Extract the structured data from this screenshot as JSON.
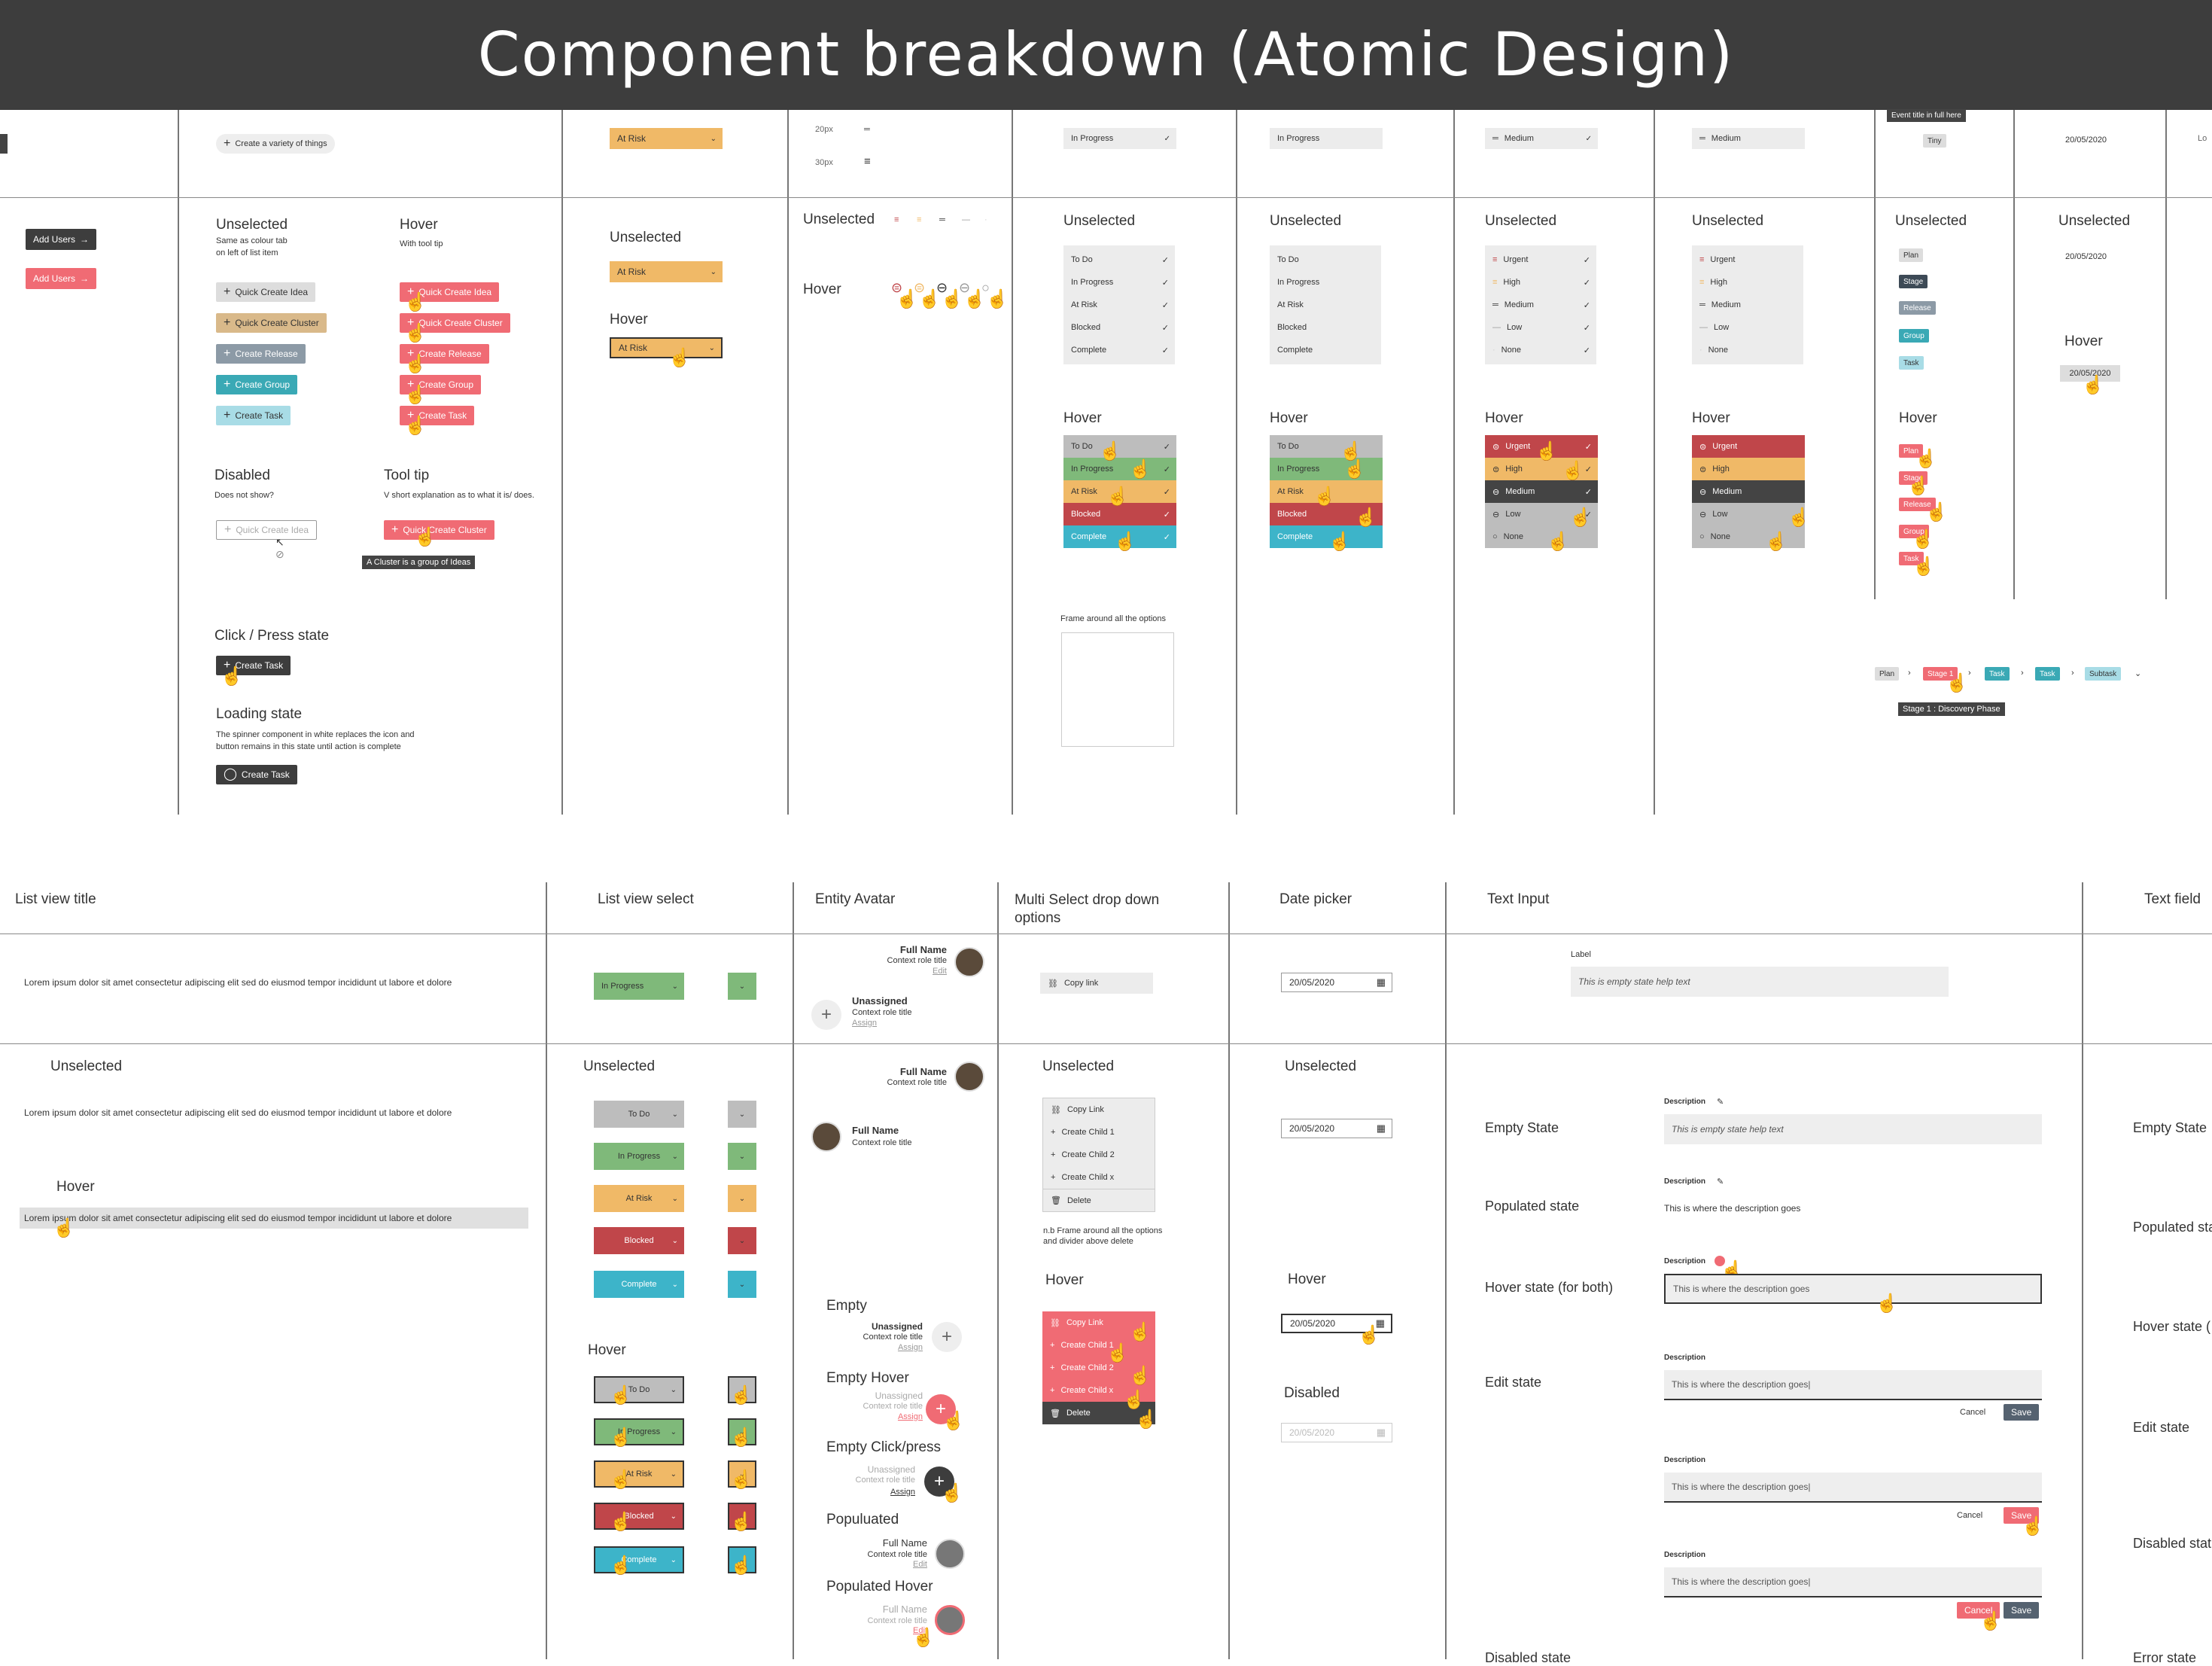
{
  "header": {
    "title": "Component breakdown (Atomic Design)"
  },
  "colors": {
    "gray": "#bdbdbd",
    "green": "#7fb97a",
    "amber": "#f0b967",
    "red": "#c0464a",
    "blue": "#3db4c9",
    "pink": "#f06b74",
    "dark": "#3d3d3d",
    "tan": "#d9b98a",
    "slate": "#8c9aa6",
    "teal": "#3aa9b5",
    "lightblue": "#a8dce6"
  },
  "top": {
    "create_variety": "Create a variety of things",
    "at_risk": "At Risk",
    "px20": "20px",
    "px30": "30px",
    "in_progress": "In Progress",
    "in_progress2": "In Progress",
    "medium": "Medium",
    "medium2": "Medium",
    "event_tip": "Event title in full here",
    "tiny": "Tiny",
    "date": "20/05/2020",
    "lo": "Lo"
  },
  "buttons": {
    "add_users": "Add Users",
    "add_users2": "Add Users",
    "unselected": "Unselected",
    "unselected_note": "Same as colour tab\non left of list item",
    "hover": "Hover",
    "hover_note": "With tool tip",
    "items": [
      "Quick Create Idea",
      "Quick Create Cluster",
      "Create Release",
      "Create Group",
      "Create Task"
    ],
    "disabled": "Disabled",
    "disabled_note": "Does not show?",
    "disabled_btn": "Quick Create Idea",
    "tooltip": "Tool tip",
    "tooltip_note": "V short explanation as to what it is/ does.",
    "tooltip_btn": "Quick Create Cluster",
    "tooltip_text": "A Cluster is a group of Ideas",
    "click": "Click / Press state",
    "click_btn": "Create Task",
    "loading": "Loading state",
    "loading_note": "The spinner component in white replaces the icon and\nbutton remains in this state until action is complete",
    "loading_btn": "Create Task"
  },
  "risk": {
    "unselected": "Unselected",
    "hover": "Hover",
    "value": "At Risk",
    "value2": "At Risk"
  },
  "icons": {
    "unselected": "Unselected",
    "hover": "Hover"
  },
  "status": {
    "unselected": "Unselected",
    "hover": "Hover",
    "options": [
      "To Do",
      "In Progress",
      "At Risk",
      "Blocked",
      "Complete"
    ],
    "frame_note": "Frame around all the options"
  },
  "status2": {
    "unselected": "Unselected",
    "hover": "Hover",
    "options": [
      "To Do",
      "In Progress",
      "At Risk",
      "Blocked",
      "Complete"
    ]
  },
  "priority": {
    "unselected": "Unselected",
    "hover": "Hover",
    "options": [
      "Urgent",
      "High",
      "Medium",
      "Low",
      "None"
    ]
  },
  "priority2": {
    "unselected": "Unselected",
    "hover": "Hover",
    "options": [
      "Urgent",
      "High",
      "Medium",
      "Low",
      "None"
    ]
  },
  "tags": {
    "unselected": "Unselected",
    "hover": "Hover",
    "items": [
      "Plan",
      "Stage",
      "Release",
      "Group",
      "Task"
    ],
    "crumbs": [
      "Plan",
      "Stage 1",
      "Task",
      "Task",
      "Subtask"
    ],
    "crumb_tip": "Stage 1 : Discovery Phase"
  },
  "datecol": {
    "unselected": "Unselected",
    "hover": "Hover",
    "value": "20/05/2020",
    "value2": "20/05/2020"
  },
  "bottom": {
    "list_title": "List view title",
    "list_select": "List view select",
    "entity": "Entity Avatar",
    "multi": "Multi Select drop down options",
    "datepicker": "Date picker",
    "textinput": "Text Input",
    "textfield": "Text field",
    "lorem": "Lorem ipsum dolor sit amet consectetur adipiscing elit sed do eiusmod tempor incididunt ut labore et dolore",
    "lv_unselected": "Unselected",
    "lv_hover": "Hover",
    "sel_unselected": "Unselected",
    "sel_hover": "Hover",
    "sel_top": "In Progress",
    "sel_options": [
      "To Do",
      "In Progress",
      "At Risk",
      "Blocked",
      "Complete"
    ],
    "full_name": "Full Name",
    "context": "Context role title",
    "edit": "Edit",
    "unassigned": "Unassigned",
    "assign": "Assign",
    "empty": "Empty",
    "empty_hover": "Empty Hover",
    "empty_click": "Empty Click/press",
    "populated": "Populuated",
    "populated_hover": "Populated Hover",
    "copy_link": "Copy link",
    "ms_unselected": "Unselected",
    "ms_hover": "Hover",
    "ms_options": [
      "Copy Link",
      "Create Child 1",
      "Create Child 2",
      "Create Child x",
      "Delete"
    ],
    "ms_hover_options": [
      "Copy Link",
      "Create Child 1",
      "Create Child 2",
      "Create Child x",
      "Delete"
    ],
    "ms_note": "n.b Frame around all the options\nand divider above delete",
    "dp_value": "20/05/2020",
    "dp_unselected": "Unselected",
    "dp_hover": "Hover",
    "dp_disabled": "Disabled",
    "ti_label": "Label",
    "ti_help": "This is empty state help text",
    "states": [
      "Empty State",
      "Populated state",
      "Hover state (for both)",
      "Edit state"
    ],
    "description": "Description",
    "desc_text": "This is where the description goes",
    "desc_edit": "This is where the description goes|",
    "cancel": "Cancel",
    "save": "Save",
    "tf_states": [
      "Empty State",
      "Populated sta",
      "Hover state (",
      "Edit state",
      "Disabled stat",
      "Error state"
    ],
    "disabled_state": "Disabled state"
  }
}
